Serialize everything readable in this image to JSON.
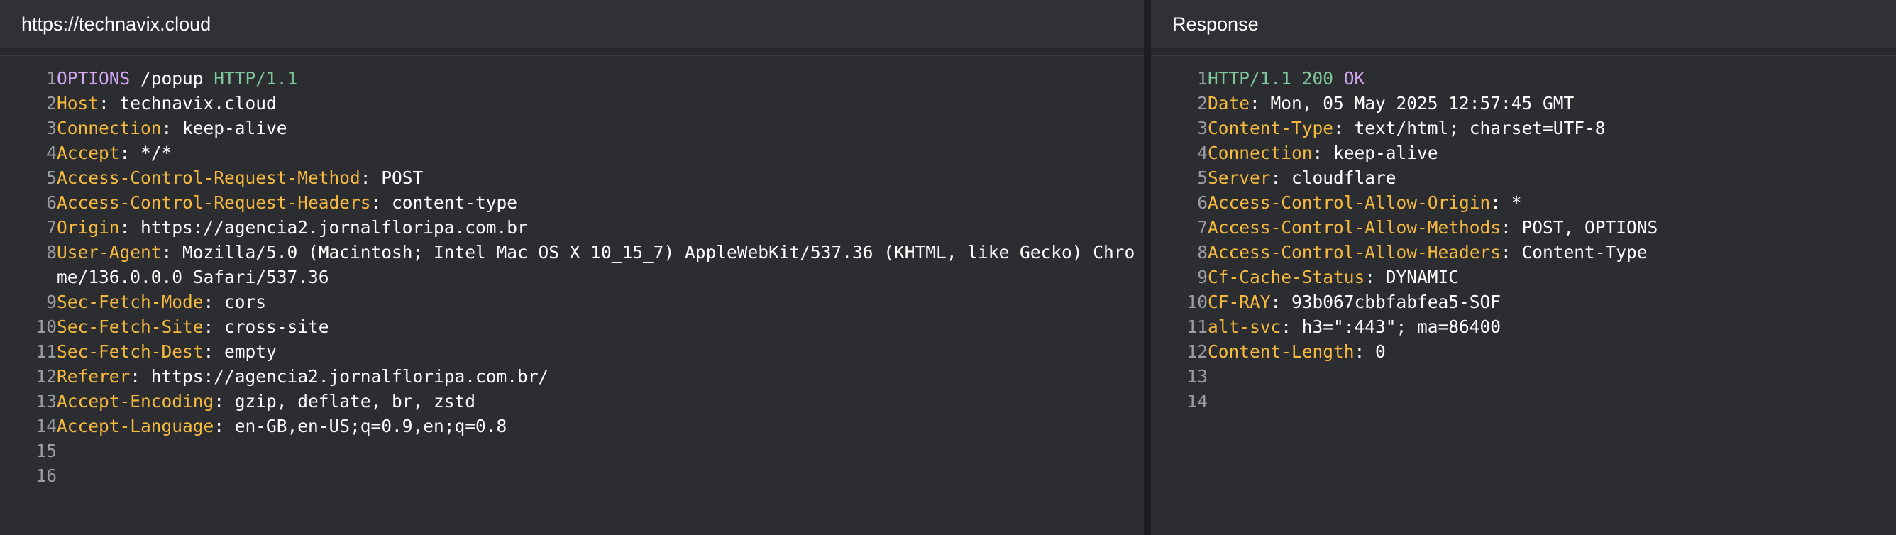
{
  "colors": {
    "background": "#2b2d31",
    "header_key": "#f5b93e",
    "method": "#d4a8f5",
    "protocol": "#7fc79b",
    "line_number": "#9a9ca3",
    "text": "#ffffff"
  },
  "request": {
    "title": "https://technavix.cloud",
    "request_line": {
      "method": "OPTIONS",
      "path": " /popup ",
      "protocol": "HTTP/1.1"
    },
    "headers": [
      {
        "key": "Host",
        "value": "technavix.cloud"
      },
      {
        "key": "Connection",
        "value": "keep-alive"
      },
      {
        "key": "Accept",
        "value": "*/*"
      },
      {
        "key": "Access-Control-Request-Method",
        "value": "POST"
      },
      {
        "key": "Access-Control-Request-Headers",
        "value": "content-type"
      },
      {
        "key": "Origin",
        "value": "https://agencia2.jornalfloripa.com.br"
      },
      {
        "key": "User-Agent",
        "value": "Mozilla/5.0 (Macintosh; Intel Mac OS X 10_15_7) AppleWebKit/537.36 (KHTML, like Gecko) Chrome/136.0.0.0 Safari/537.36"
      },
      {
        "key": "Sec-Fetch-Mode",
        "value": "cors"
      },
      {
        "key": "Sec-Fetch-Site",
        "value": "cross-site"
      },
      {
        "key": "Sec-Fetch-Dest",
        "value": "empty"
      },
      {
        "key": "Referer",
        "value": "https://agencia2.jornalfloripa.com.br/"
      },
      {
        "key": "Accept-Encoding",
        "value": "gzip, deflate, br, zstd"
      },
      {
        "key": "Accept-Language",
        "value": "en-GB,en-US;q=0.9,en;q=0.8"
      }
    ],
    "line_numbers": [
      "1",
      "2",
      "3",
      "4",
      "5",
      "6",
      "7",
      "8",
      "9",
      "10",
      "11",
      "12",
      "13",
      "14",
      "15",
      "16"
    ]
  },
  "response": {
    "title": "Response",
    "status_line": {
      "protocol": "HTTP/1.1",
      "code": " 200 ",
      "reason": "OK"
    },
    "headers": [
      {
        "key": "Date",
        "value": "Mon, 05 May 2025 12:57:45 GMT"
      },
      {
        "key": "Content-Type",
        "value": "text/html; charset=UTF-8"
      },
      {
        "key": "Connection",
        "value": "keep-alive"
      },
      {
        "key": "Server",
        "value": "cloudflare"
      },
      {
        "key": "Access-Control-Allow-Origin",
        "value": "*"
      },
      {
        "key": "Access-Control-Allow-Methods",
        "value": "POST, OPTIONS"
      },
      {
        "key": "Access-Control-Allow-Headers",
        "value": "Content-Type"
      },
      {
        "key": "Cf-Cache-Status",
        "value": "DYNAMIC"
      },
      {
        "key": "CF-RAY",
        "value": "93b067cbbfabfea5-SOF"
      },
      {
        "key": "alt-svc",
        "value": "h3=\":443\"; ma=86400"
      },
      {
        "key": "Content-Length",
        "value": "0"
      }
    ],
    "line_numbers": [
      "1",
      "2",
      "3",
      "4",
      "5",
      "6",
      "7",
      "8",
      "9",
      "10",
      "11",
      "12",
      "13",
      "14"
    ]
  },
  "separator": ": "
}
